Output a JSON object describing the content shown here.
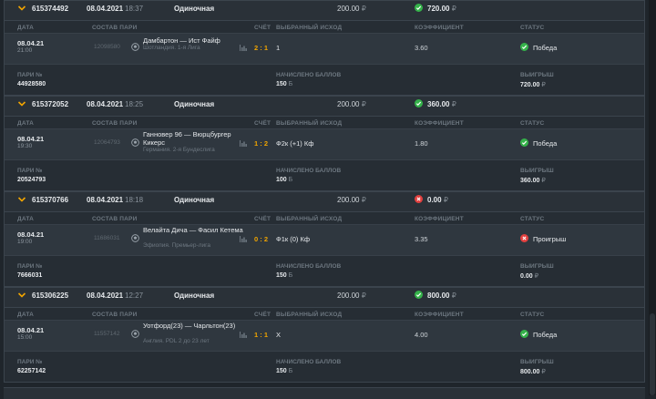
{
  "currency": "₽",
  "points_sign": "Б",
  "columns": {
    "date": "ДАТА",
    "pair": "СОСТАВ ПАРИ",
    "score": "СЧЁТ",
    "outcome": "ВЫБРАННЫЙ ИСХОД",
    "coef": "КОЭФФИЦИЕНТ",
    "status": "СТАТУС"
  },
  "footer_labels": {
    "pair_no": "ПАРИ №",
    "points": "НАЧИСЛЕНО БАЛЛОВ",
    "win": "ВЫИГРЫШ"
  },
  "bets": [
    {
      "id": "615374492",
      "date": "08.04.2021",
      "time": "18:37",
      "type": "Одиночная",
      "amount": "200.00",
      "result": "720.00",
      "won": true,
      "event": {
        "date": "08.04.21",
        "time": "21:00",
        "event_id": "12098580",
        "name": "Дамбартон — Ист Файф",
        "league": "Шотландия. 1-я Лига",
        "score": "2 : 1",
        "outcome": "1",
        "coef": "3.60",
        "status": "Победа"
      },
      "pair_no": "44928580",
      "points": "150",
      "win": "720.00"
    },
    {
      "id": "615372052",
      "date": "08.04.2021",
      "time": "18:25",
      "type": "Одиночная",
      "amount": "200.00",
      "result": "360.00",
      "won": true,
      "event": {
        "date": "08.04.21",
        "time": "19:30",
        "event_id": "12064793",
        "name": "Ганновер 96 — Вюрцбургер Кикерс",
        "league": "Германия. 2-я Бундеслига",
        "score": "1 : 2",
        "outcome": "Ф2к (+1) Кф",
        "coef": "1.80",
        "status": "Победа"
      },
      "pair_no": "20524793",
      "points": "100",
      "win": "360.00"
    },
    {
      "id": "615370766",
      "date": "08.04.2021",
      "time": "18:18",
      "type": "Одиночная",
      "amount": "200.00",
      "result": "0.00",
      "won": false,
      "event": {
        "date": "08.04.21",
        "time": "19:00",
        "event_id": "11686031",
        "name": "Велайта Дича — Фасил Кетема",
        "league": "Эфиопия. Премьер-лига",
        "score": "0 : 2",
        "outcome": "Ф1к (0) Кф",
        "coef": "3.35",
        "status": "Проигрыш"
      },
      "pair_no": "7666031",
      "points": "150",
      "win": "0.00"
    },
    {
      "id": "615306225",
      "date": "08.04.2021",
      "time": "12:27",
      "type": "Одиночная",
      "amount": "200.00",
      "result": "800.00",
      "won": true,
      "event": {
        "date": "08.04.21",
        "time": "15:00",
        "event_id": "11557142",
        "name": "Уотфорд(23) — Чарльтон(23)",
        "league": "Англия. PDL 2 до 23 лет",
        "score": "1 : 1",
        "outcome": "X",
        "coef": "4.00",
        "status": "Победа"
      },
      "pair_no": "62257142",
      "points": "150",
      "win": "800.00"
    }
  ]
}
